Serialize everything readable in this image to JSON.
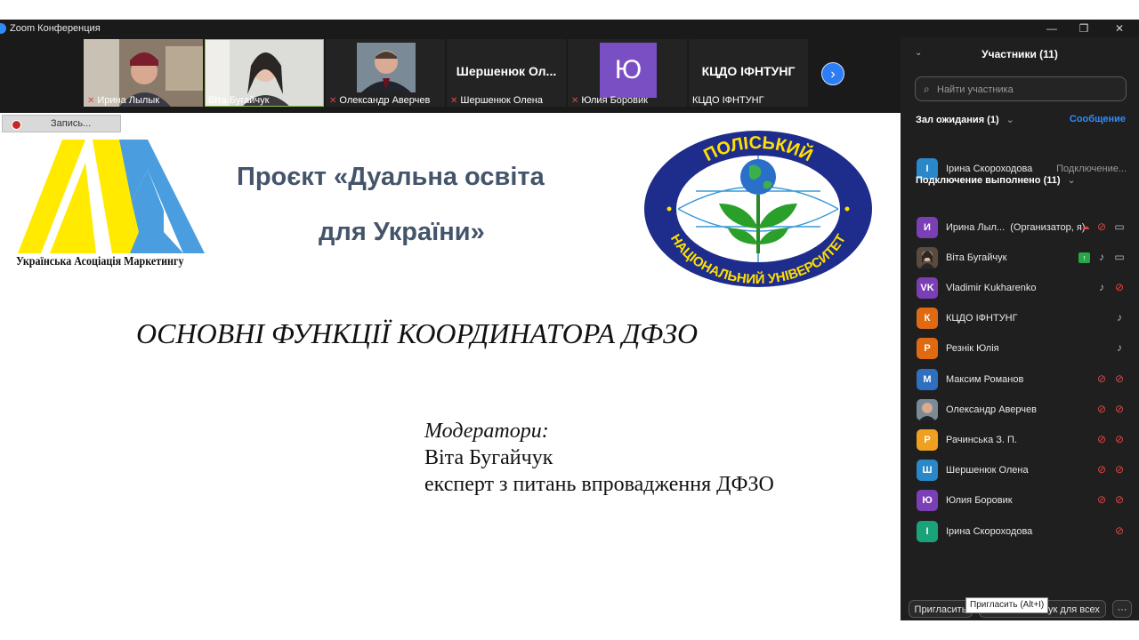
{
  "window": {
    "title": "Zoom Конференция",
    "min": "—",
    "restore": "❐",
    "close": "✕"
  },
  "videos": [
    {
      "name": "Ирина Лылык"
    },
    {
      "name": "Віта Бугайчук"
    },
    {
      "name": "Олександр Аверчев"
    },
    {
      "name": "Шершенюк Олена",
      "big": "Шершенюк  Ол..."
    },
    {
      "name": "Юлия Боровик",
      "letter": "Ю"
    },
    {
      "name": "КЦДО ІФНТУНГ",
      "big": "КЦДО ІФНТУНГ"
    }
  ],
  "next_icon": "›",
  "recording": {
    "label": "Запись..."
  },
  "slide": {
    "logo_text": "Українська Асоціація Маркетингу",
    "project_line1": "Проєкт «Дуальна освіта",
    "project_line2": "для України»",
    "seal_top": "ПОЛІСЬКИЙ",
    "seal_bottom": "НАЦІОНАЛЬНИЙ УНІВЕРСИТЕТ",
    "functions_title": "ОСНОВНІ ФУНКЦІЇ КООРДИНАТОРА ДФЗО",
    "moderators_heading": "Модератори:",
    "moderator_name": "Віта Бугайчук",
    "moderator_role": "експерт з питань впровадження ДФЗО"
  },
  "panel": {
    "title": "Участники (11)",
    "search_placeholder": "Найти участника",
    "waiting_label": "Зал ожидания (1)",
    "message_link": "Сообщение",
    "waiting_person": {
      "name": "Ірина Скороходова",
      "status": "Подключение...",
      "initial": "І"
    },
    "connected_label": "Подключение выполнено (11)",
    "participants": [
      {
        "name": "Ирина Лыл...",
        "role": "(Организатор, я)",
        "initial": "И",
        "color": "#7b3fb5"
      },
      {
        "name": "Віта Бугайчук",
        "initial": "",
        "color": "#5a4a40"
      },
      {
        "name": "Vladimir Kukharenko",
        "initial": "VK",
        "color": "#7b3fb5"
      },
      {
        "name": "КЦДО ІФНТУНГ",
        "initial": "К",
        "color": "#e06a12"
      },
      {
        "name": "Резнік Юлія",
        "initial": "Р",
        "color": "#e06a12"
      },
      {
        "name": "Максим Романов",
        "initial": "М",
        "color": "#2e6fbf"
      },
      {
        "name": "Олександр Аверчев",
        "initial": "",
        "color": "#4a4a4a"
      },
      {
        "name": "Рачинська З. П.",
        "initial": "Р",
        "color": "#f0a020"
      },
      {
        "name": "Шершенюк Олена",
        "initial": "Ш",
        "color": "#2a88c8"
      },
      {
        "name": "Юлия Боровик",
        "initial": "Ю",
        "color": "#7b3fb5"
      },
      {
        "name": "Ірина Скороходова",
        "initial": "І",
        "color": "#1aa37a"
      }
    ],
    "invite_button": "Пригласить",
    "mute_all_button": "Выключить звук для всех",
    "more_button": "···",
    "tooltip": "Пригласить (Alt+I)"
  },
  "colors": {
    "accent": "#2d8cff",
    "muted": "#e04848",
    "slide_title": "#44546a",
    "logo_yellow": "#ffea00",
    "logo_blue": "#4a9ee0"
  }
}
